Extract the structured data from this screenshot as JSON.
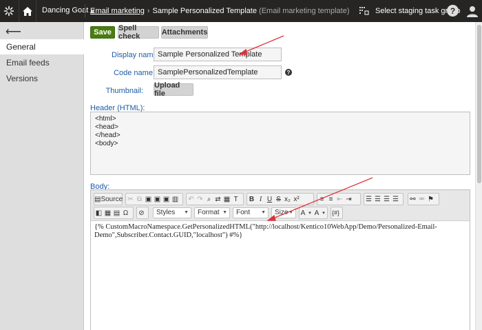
{
  "topbar": {
    "site_name": "Dancing Goat",
    "breadcrumb_link": "Email marketing",
    "breadcrumb_sep": "›",
    "breadcrumb_current": "Sample Personalized Template",
    "breadcrumb_type": "(Email marketing template)",
    "staging_label": "Select staging task group",
    "help_label": "?",
    "icons": [
      "kentico-logo-icon",
      "home-icon",
      "staging-icon",
      "help-icon",
      "user-icon"
    ]
  },
  "sidebar": {
    "back_glyph": "⟵",
    "items": [
      {
        "label": "General",
        "active": true
      },
      {
        "label": "Email feeds",
        "active": false
      },
      {
        "label": "Versions",
        "active": false
      }
    ]
  },
  "actions": {
    "save": "Save",
    "spell_check": "Spell check",
    "attachments": "Attachments"
  },
  "form": {
    "display_name_label": "Display name:",
    "display_name_required": "*",
    "display_name_value": "Sample Personalized Template",
    "code_name_label": "Code name:",
    "code_name_value": "SamplePersonalizedTemplate",
    "thumbnail_label": "Thumbnail:",
    "upload_button": "Upload file",
    "header_label": "Header (HTML):",
    "header_lines": [
      "<html>",
      "<head>",
      "</head>",
      "<body>"
    ],
    "body_label": "Body:"
  },
  "editor": {
    "source_label": "Source",
    "styles": "Styles",
    "format": "Format",
    "font": "Font",
    "size": "Size",
    "content": "{% CustomMacroNamespace.GetPersonalizedHTML(\"http://localhost/Kentico10WebApp/Demo/Personalized-Email-Demo\",Subscriber.Contact.GUID,\"localhost\") #%}"
  },
  "colors": {
    "topbar": "#262524",
    "save": "#497d10",
    "label": "#1d5aa6",
    "arrow": "#d9363b"
  }
}
